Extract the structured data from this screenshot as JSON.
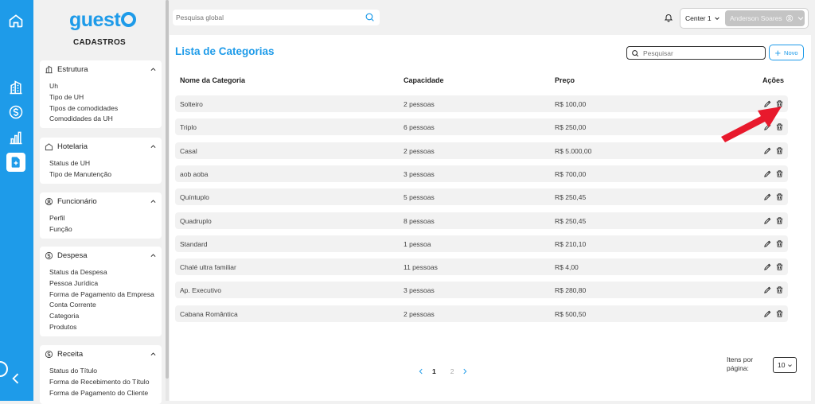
{
  "app": {
    "logo_text": "guest",
    "section_title": "CADASTROS"
  },
  "rail": {
    "icons": [
      "home-icon",
      "building-icon",
      "dollar-icon",
      "chart-icon",
      "file-add-icon",
      "collapse-chevron-icon"
    ],
    "active": "file-add-icon"
  },
  "sidebar": {
    "groups": [
      {
        "title": "Estrutura",
        "icon": "building-icon",
        "items": [
          "Uh",
          "Tipo de UH",
          "Tipos de comodidades",
          "Comodidades da UH"
        ]
      },
      {
        "title": "Hotelaria",
        "icon": "home-icon",
        "items": [
          "Status de UH",
          "Tipo de Manutenção"
        ]
      },
      {
        "title": "Funcionário",
        "icon": "user-circle-icon",
        "items": [
          "Perfil",
          "Função"
        ]
      },
      {
        "title": "Despesa",
        "icon": "dollar-icon",
        "items": [
          "Status da Despesa",
          "Pessoa Jurídica",
          "Forma de Pagamento da Empresa",
          "Conta Corrente",
          "Categoria",
          "Produtos"
        ]
      },
      {
        "title": "Receita",
        "icon": "dollar-icon",
        "items": [
          "Status do Título",
          "Forma de Recebimento do Título",
          "Forma de Pagamento do Cliente"
        ]
      }
    ]
  },
  "topbar": {
    "search_placeholder": "Pesquisa global",
    "center_label": "Center 1",
    "user_name": "Anderson Soares"
  },
  "main": {
    "title": "Lista de Categorias",
    "search_placeholder": "Pesquisar",
    "new_label": "Novo",
    "columns": [
      "Nome da Categoria",
      "Capacidade",
      "Preço",
      "Ações"
    ],
    "rows": [
      {
        "name": "Solteiro",
        "capacity": "2 pessoas",
        "price": "R$ 100,00"
      },
      {
        "name": "Triplo",
        "capacity": "6 pessoas",
        "price": "R$ 250,00"
      },
      {
        "name": "Casal",
        "capacity": "2 pessoas",
        "price": "R$ 5.000,00"
      },
      {
        "name": "aob aoba",
        "capacity": "3 pessoas",
        "price": "R$ 700,00"
      },
      {
        "name": "Quíntuplo",
        "capacity": "5 pessoas",
        "price": "R$ 250,45"
      },
      {
        "name": "Quadruplo",
        "capacity": "8 pessoas",
        "price": "R$ 250,45"
      },
      {
        "name": "Standard",
        "capacity": "1 pessoa",
        "price": "R$ 210,10"
      },
      {
        "name": "Chalé ultra familiar",
        "capacity": "11 pessoas",
        "price": "R$ 4,00"
      },
      {
        "name": "Ap. Executivo",
        "capacity": "3 pessoas",
        "price": "R$ 280,80"
      },
      {
        "name": "Cabana Romântica",
        "capacity": "2 pessoas",
        "price": "R$ 500,50"
      }
    ],
    "pagination": {
      "pages": [
        "1",
        "2"
      ],
      "current": "1"
    },
    "per_page_label": "Itens por página:",
    "per_page_value": "10"
  },
  "colors": {
    "accent": "#1e9be9",
    "annotation_arrow": "#e8192c"
  }
}
